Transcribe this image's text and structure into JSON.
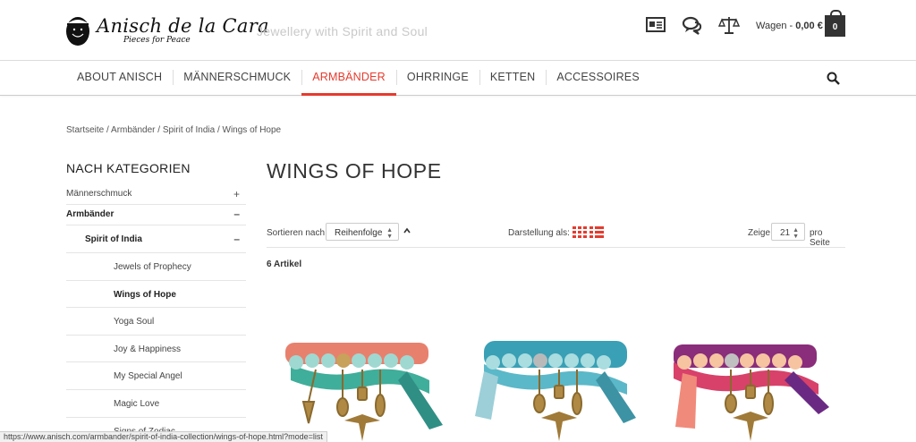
{
  "header": {
    "brand_title": "Anisch de la Cara",
    "brand_subtitle": "Pieces for Peace",
    "tagline": "Jewellery with Spirit and Soul",
    "icons": [
      "contact-card-icon",
      "chat-icon",
      "scales-icon",
      "shopping-bag-icon"
    ],
    "cart_label": "Wagen - ",
    "cart_amount": "0,00 €",
    "cart_count": "0"
  },
  "nav": {
    "items": [
      "ABOUT ANISCH",
      "MÄNNERSCHMUCK",
      "ARMBÄNDER",
      "OHRRINGE",
      "KETTEN",
      "ACCESSOIRES"
    ],
    "active_index": 2,
    "accent_color": "#e63b2e"
  },
  "breadcrumb": "Startseite / Armbänder / Spirit of India / Wings of Hope",
  "sidebar": {
    "title": "NACH KATEGORIEN",
    "categories": [
      {
        "label": "Männerschmuck",
        "toggle": "+"
      },
      {
        "label": "Armbänder",
        "toggle": "–"
      },
      {
        "label": "Spirit of India",
        "toggle": "–"
      }
    ],
    "subcategories": [
      "Jewels of Prophecy",
      "Wings of Hope",
      "Yoga Soul",
      "Joy & Happiness",
      "My Special Angel",
      "Magic Love",
      "Signs of Zodiac"
    ],
    "current": "Wings of Hope"
  },
  "main": {
    "title": "WINGS OF HOPE",
    "sort_label": "Sortieren nach",
    "sort_value": "Reihenfolge",
    "view_label": "Darstellung als:",
    "per_page_prefix": "Zeige",
    "per_page_value": "21",
    "per_page_suffix": "pro Seite",
    "count": "6 Artikel"
  },
  "products": [
    {
      "name": "wings-of-hope-bracelet-coral",
      "ribbon": "#e8806e",
      "ribbon2": "#3fae9a"
    },
    {
      "name": "wings-of-hope-bracelet-turquoise",
      "ribbon": "#3aa0b5",
      "ribbon2": "#5bb8c8"
    },
    {
      "name": "wings-of-hope-bracelet-purple",
      "ribbon": "#8a2d7a",
      "ribbon2": "#d8416a"
    }
  ],
  "statusbar": "https://www.anisch.com/armbander/spirit-of-india-collection/wings-of-hope.html?mode=list"
}
